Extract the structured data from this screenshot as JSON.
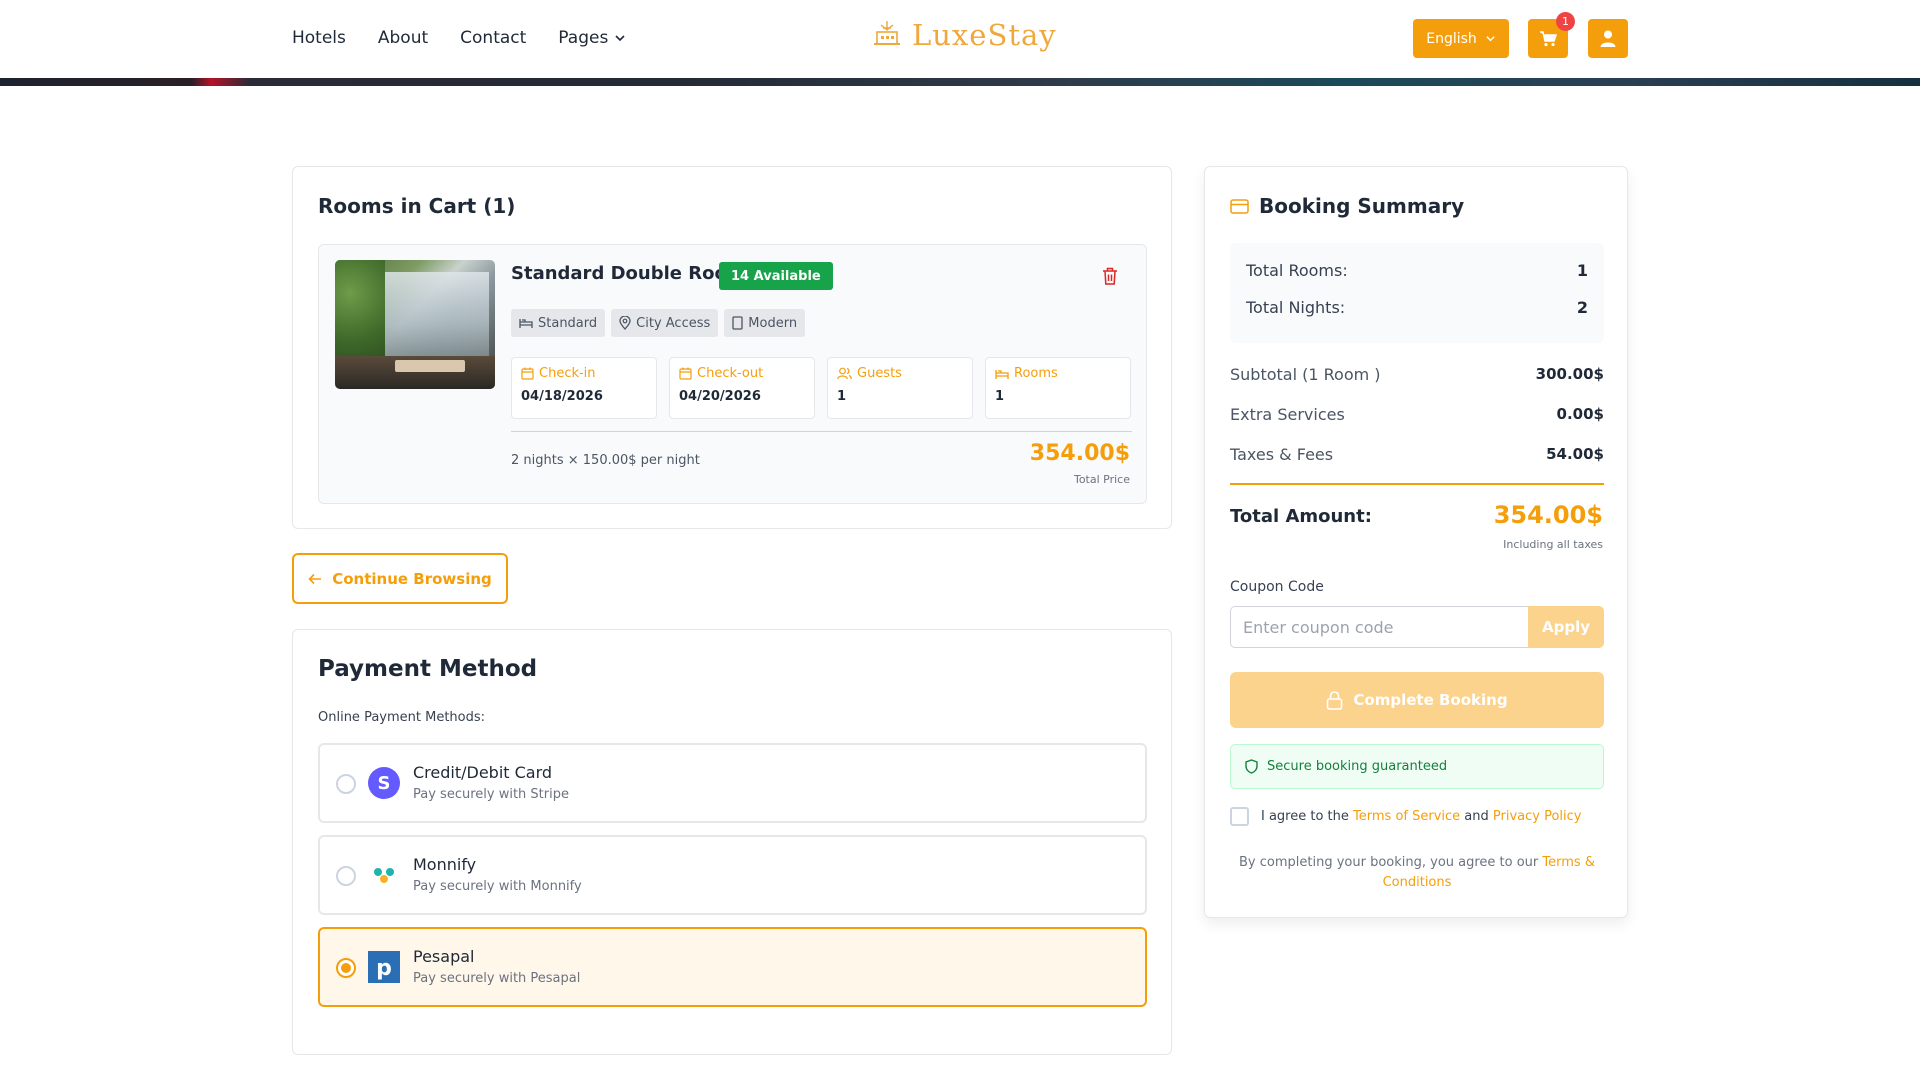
{
  "header": {
    "nav": [
      "Hotels",
      "About",
      "Contact",
      "Pages"
    ],
    "brand": "LuxeStay",
    "language": "English",
    "cart_count": "1",
    "icons": {
      "cart": "cart-icon",
      "user": "user-icon",
      "dropdown": "chevron-down-icon"
    }
  },
  "cart": {
    "title": "Rooms in Cart (1)",
    "room": {
      "name": "Standard Double Room",
      "availability": "14 Available",
      "tags": [
        "Standard",
        "City Access",
        "Modern"
      ],
      "checkin_label": "Check-in",
      "checkin_value": "04/18/2026",
      "checkout_label": "Check-out",
      "checkout_value": "04/20/2026",
      "guests_label": "Guests",
      "guests_value": "1",
      "rooms_label": "Rooms",
      "rooms_value": "1",
      "nights_text": "2 nights × 150.00$ per night",
      "total_price": "354.00$",
      "total_price_label": "Total Price"
    }
  },
  "continue_label": "Continue Browsing",
  "payment": {
    "title": "Payment Method",
    "subtitle": "Online Payment Methods:",
    "methods": [
      {
        "name": "Credit/Debit Card",
        "desc": "Pay securely with Stripe",
        "selected": false
      },
      {
        "name": "Monnify",
        "desc": "Pay securely with Monnify",
        "selected": false
      },
      {
        "name": "Pesapal",
        "desc": "Pay securely with Pesapal",
        "selected": true
      }
    ]
  },
  "summary": {
    "title": "Booking Summary",
    "total_rooms_label": "Total Rooms:",
    "total_rooms_value": "1",
    "total_nights_label": "Total Nights:",
    "total_nights_value": "2",
    "subtotal_label": "Subtotal (1 Room )",
    "subtotal_value": "300.00$",
    "extra_label": "Extra Services",
    "extra_value": "0.00$",
    "taxes_label": "Taxes & Fees",
    "taxes_value": "54.00$",
    "total_label": "Total Amount:",
    "total_value": "354.00$",
    "total_note": "Including all taxes",
    "coupon_label": "Coupon Code",
    "coupon_placeholder": "Enter coupon code",
    "apply_label": "Apply",
    "complete_label": "Complete Booking",
    "secure_text": "Secure booking guaranteed",
    "agree_prefix": "I agree to the",
    "terms_link": "Terms of Service",
    "agree_and": "and",
    "privacy_link": "Privacy Policy",
    "fine_prefix": "By completing your booking, you agree to our",
    "fine_link": "Terms & Conditions"
  },
  "colors": {
    "accent": "#f59e0b",
    "success": "#16a34a",
    "danger": "#dc2626"
  }
}
